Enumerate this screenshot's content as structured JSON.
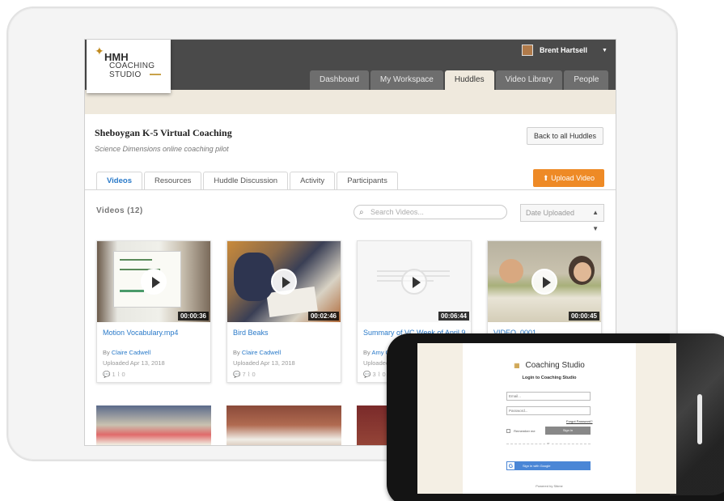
{
  "brand": {
    "line1": "HMH",
    "line2": "COACHING",
    "line3": "STUDIO"
  },
  "user": {
    "name": "Brent Hartsell"
  },
  "nav": {
    "tabs": [
      {
        "label": "Dashboard"
      },
      {
        "label": "My Workspace"
      },
      {
        "label": "Huddles"
      },
      {
        "label": "Video Library"
      },
      {
        "label": "People"
      }
    ],
    "active": "Huddles"
  },
  "huddle": {
    "title": "Sheboygan K-5 Virtual Coaching",
    "subtitle": "Science Dimensions online coaching pilot",
    "back_label": "Back to all Huddles",
    "upload_label": "Upload Video"
  },
  "section_tabs": [
    {
      "label": "Videos"
    },
    {
      "label": "Resources"
    },
    {
      "label": "Huddle Discussion"
    },
    {
      "label": "Activity"
    },
    {
      "label": "Participants"
    }
  ],
  "videos": {
    "count_label": "Videos (12)",
    "search_placeholder": "Search Videos...",
    "sort_label": "Date Uploaded",
    "by_prefix": "By",
    "cards": [
      {
        "title": "Motion Vocabulary.mp4",
        "duration": "00:00:36",
        "author": "Claire Cadwell",
        "uploaded": "Uploaded Apr 13, 2018",
        "comments": "1",
        "attachments": "0"
      },
      {
        "title": "Bird Beaks",
        "duration": "00:02:46",
        "author": "Claire Cadwell",
        "uploaded": "Uploaded Apr 13, 2018",
        "comments": "7",
        "attachments": "0"
      },
      {
        "title": "Summary of VC Week of April 9",
        "duration": "00:06:44",
        "author": "Amy Groff",
        "uploaded": "Uploaded Ap",
        "comments": "3",
        "attachments": "0"
      },
      {
        "title": "VIDEO_0001",
        "duration": "00:00:45",
        "author": "",
        "uploaded": "",
        "comments": "",
        "attachments": ""
      }
    ]
  },
  "phone_login": {
    "brand": "Coaching Studio",
    "subtitle": "Login to Coaching Studio",
    "email_placeholder": "Email...",
    "password_placeholder": "Password...",
    "forgot": "Forgot Password?",
    "remember": "Remember me",
    "sign_in": "Sign in",
    "or": "or",
    "google": "Sign in with Google",
    "powered": "Powered by Sibme"
  },
  "colors": {
    "accent_blue": "#2a7ac9",
    "upload_orange": "#ee8a26",
    "topbar": "#4a4a4a",
    "header_beige": "#efe9dd"
  }
}
